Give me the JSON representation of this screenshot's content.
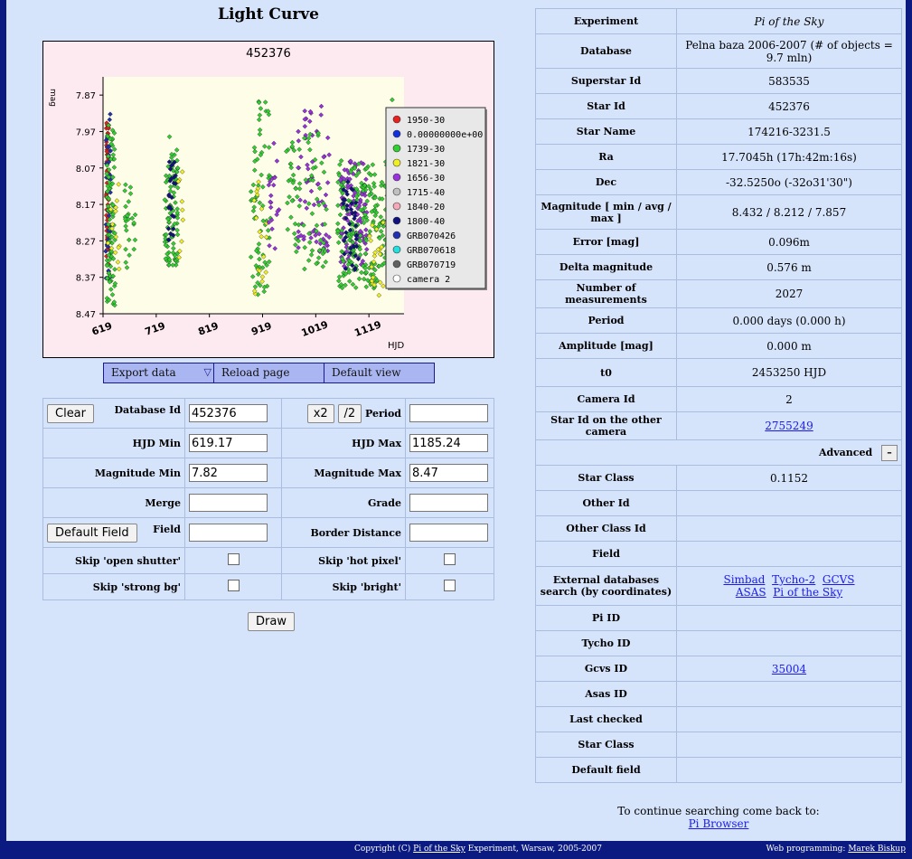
{
  "title": "Light Curve",
  "chart_data": {
    "type": "scatter",
    "title": "452376",
    "xlabel": "HJD",
    "ylabel": "mag",
    "xticks": [
      "619",
      "719",
      "819",
      "919",
      "1019",
      "1119"
    ],
    "yticks": [
      "7.87",
      "7.97",
      "8.07",
      "8.17",
      "8.27",
      "8.37",
      "8.47"
    ],
    "xlim": [
      619,
      1185
    ],
    "ylim": [
      8.47,
      7.82
    ],
    "grid": false,
    "legend_position": "right",
    "series": [
      {
        "name": "1950-30",
        "color": "#e82020"
      },
      {
        "name": "0.00000000e+00",
        "color": "#1030e0"
      },
      {
        "name": "1739-30",
        "color": "#30d030"
      },
      {
        "name": "1821-30",
        "color": "#f0f020"
      },
      {
        "name": "1656-30",
        "color": "#9a30e0"
      },
      {
        "name": "1715-40",
        "color": "#c0c0c0"
      },
      {
        "name": "1840-20",
        "color": "#f4a8b8"
      },
      {
        "name": "1800-40",
        "color": "#101080"
      },
      {
        "name": "GRB070426",
        "color": "#2030b0"
      },
      {
        "name": "GRB070618",
        "color": "#20e0e0"
      },
      {
        "name": "GRB070719",
        "color": "#606060"
      },
      {
        "name": "camera 2",
        "color": "#ffffff"
      }
    ],
    "point_clusters": [
      {
        "series": 0,
        "x_range": [
          625,
          630
        ],
        "y_range": [
          7.93,
          8.38
        ],
        "count": 70
      },
      {
        "series": 8,
        "x_range": [
          624,
          634
        ],
        "y_range": [
          7.92,
          8.4
        ],
        "count": 40
      },
      {
        "series": 2,
        "x_range": [
          626,
          642
        ],
        "y_range": [
          7.95,
          8.45
        ],
        "count": 90
      },
      {
        "series": 3,
        "x_range": [
          628,
          650
        ],
        "y_range": [
          8.1,
          8.4
        ],
        "count": 15
      },
      {
        "series": 2,
        "x_range": [
          660,
          680
        ],
        "y_range": [
          8.1,
          8.35
        ],
        "count": 25
      },
      {
        "series": 2,
        "x_range": [
          735,
          760
        ],
        "y_range": [
          7.98,
          8.35
        ],
        "count": 90
      },
      {
        "series": 7,
        "x_range": [
          740,
          756
        ],
        "y_range": [
          8.05,
          8.3
        ],
        "count": 25
      },
      {
        "series": 3,
        "x_range": [
          760,
          770
        ],
        "y_range": [
          8.05,
          8.35
        ],
        "count": 10
      },
      {
        "series": 2,
        "x_range": [
          897,
          935
        ],
        "y_range": [
          7.88,
          8.42
        ],
        "count": 70
      },
      {
        "series": 3,
        "x_range": [
          900,
          930
        ],
        "y_range": [
          8.1,
          8.42
        ],
        "count": 20
      },
      {
        "series": 4,
        "x_range": [
          930,
          950
        ],
        "y_range": [
          7.95,
          8.3
        ],
        "count": 20
      },
      {
        "series": 2,
        "x_range": [
          960,
          990
        ],
        "y_range": [
          8.0,
          8.3
        ],
        "count": 35
      },
      {
        "series": 4,
        "x_range": [
          985,
          1045
        ],
        "y_range": [
          7.9,
          8.3
        ],
        "count": 70
      },
      {
        "series": 2,
        "x_range": [
          995,
          1040
        ],
        "y_range": [
          7.95,
          8.35
        ],
        "count": 45
      },
      {
        "series": 4,
        "x_range": [
          1065,
          1115
        ],
        "y_range": [
          8.05,
          8.35
        ],
        "count": 110
      },
      {
        "series": 2,
        "x_range": [
          1060,
          1160
        ],
        "y_range": [
          8.05,
          8.4
        ],
        "count": 230
      },
      {
        "series": 7,
        "x_range": [
          1070,
          1100
        ],
        "y_range": [
          8.1,
          8.35
        ],
        "count": 40
      },
      {
        "series": 3,
        "x_range": [
          1120,
          1150
        ],
        "y_range": [
          8.2,
          8.42
        ],
        "count": 20
      },
      {
        "series": 2,
        "x_range": [
          1150,
          1170
        ],
        "y_range": [
          7.86,
          8.3
        ],
        "count": 25
      }
    ]
  },
  "chart_menu": {
    "export": "Export data",
    "reload": "Reload page",
    "default_view": "Default view"
  },
  "form": {
    "clear_label": "Clear",
    "database_id_label": "Database Id",
    "database_id_value": "452376",
    "x2_label": "x2",
    "half_label": "/2",
    "period_label": "Period",
    "period_value": "",
    "hjd_min_label": "HJD Min",
    "hjd_min_value": "619.17",
    "hjd_max_label": "HJD Max",
    "hjd_max_value": "1185.24",
    "mag_min_label": "Magnitude Min",
    "mag_min_value": "7.82",
    "mag_max_label": "Magnitude Max",
    "mag_max_value": "8.47",
    "merge_label": "Merge",
    "merge_value": "",
    "grade_label": "Grade",
    "grade_value": "",
    "default_field_label": "Default Field",
    "field_label": "Field",
    "field_value": "",
    "border_distance_label": "Border Distance",
    "border_distance_value": "",
    "skip_open_shutter": "Skip 'open shutter'",
    "skip_hot_pixel": "Skip 'hot pixel'",
    "skip_strong_bg": "Skip 'strong bg'",
    "skip_bright": "Skip 'bright'",
    "draw_label": "Draw"
  },
  "info": {
    "experiment_label": "Experiment",
    "experiment": "Pi of the Sky",
    "database_label": "Database",
    "database": "Pelna baza 2006-2007 (# of objects = 9.7 mln)",
    "superstar_label": "Superstar Id",
    "superstar": "583535",
    "star_id_label": "Star Id",
    "star_id": "452376",
    "star_name_label": "Star Name",
    "star_name": "174216-3231.5",
    "ra_label": "Ra",
    "ra": "17.7045h   (17h:42m:16s)",
    "dec_label": "Dec",
    "dec": "-32.5250o   (-32o31'30\")",
    "magnitude_label": "Magnitude [ min / avg / max ]",
    "magnitude": "8.432 / 8.212 / 7.857",
    "error_label": "Error [mag]",
    "error": "0.096m",
    "delta_label": "Delta magnitude",
    "delta": "0.576 m",
    "nmeas_label": "Number of measurements",
    "nmeas": "2027",
    "period_label": "Period",
    "period": "0.000 days   (0.000 h)",
    "amplitude_label": "Amplitude [mag]",
    "amplitude": "0.000 m",
    "t0_label": "t0",
    "t0": "2453250 HJD",
    "camera_label": "Camera Id",
    "camera": "2",
    "other_camera_label": "Star Id on the other camera",
    "other_camera": "2755249",
    "advanced_label": "Advanced",
    "advanced_toggle": "–",
    "star_class_label": "Star Class",
    "star_class": "0.1152",
    "other_id_label": "Other Id",
    "other_id": "",
    "other_class_label": "Other Class Id",
    "other_class": "",
    "field_label": "Field",
    "field": "",
    "ext_label": "External databases search (by coordinates)",
    "ext_links": [
      "Simbad",
      "Tycho-2",
      "GCVS",
      "ASAS",
      "Pi of the Sky"
    ],
    "pi_id_label": "Pi ID",
    "pi_id": "",
    "tycho_id_label": "Tycho ID",
    "tycho_id": "",
    "gcvs_id_label": "Gcvs ID",
    "gcvs_id": "35004",
    "asas_id_label": "Asas ID",
    "asas_id": "",
    "last_checked_label": "Last checked",
    "last_checked": "",
    "star_class2_label": "Star Class",
    "star_class2": "",
    "default_field_label": "Default field",
    "default_field": ""
  },
  "continue": {
    "text": "To continue searching come back to:",
    "link": "Pi Browser"
  },
  "footer": {
    "copyright_pre": "Copyright (C)",
    "copyright_link": "Pi of the Sky",
    "copyright_post": "Experiment, Warsaw, 2005-2007",
    "web_label": "Web programming:",
    "web_author": "Marek Biskup"
  }
}
